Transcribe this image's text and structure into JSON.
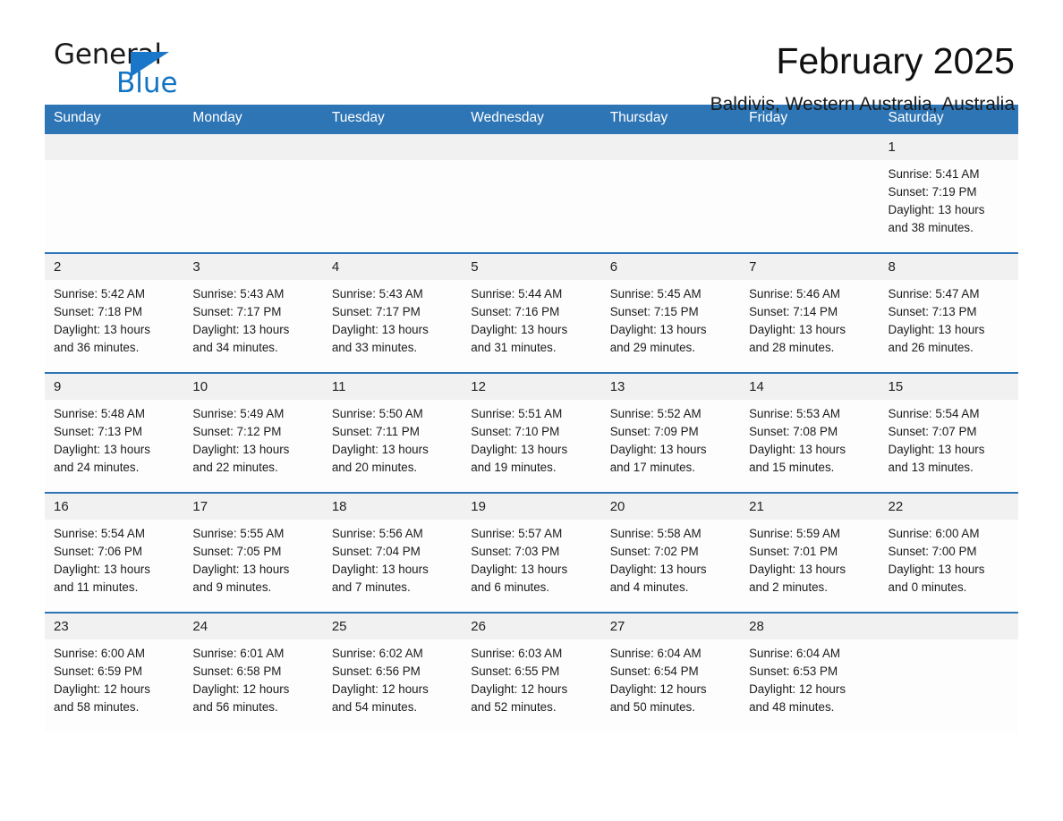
{
  "brand": {
    "name_part1": "General",
    "name_part2": "Blue",
    "triangle_color": "#1976c8",
    "blue_text_color": "#1275c4"
  },
  "header": {
    "title": "February 2025",
    "subtitle": "Baldivis, Western Australia, Australia",
    "accent_color": "#2e75b6",
    "daynum_band_color": "#f1f1f1"
  },
  "calendar": {
    "weekday_headers": [
      "Sunday",
      "Monday",
      "Tuesday",
      "Wednesday",
      "Thursday",
      "Friday",
      "Saturday"
    ],
    "weeks": [
      [
        {
          "day": "",
          "lines": []
        },
        {
          "day": "",
          "lines": []
        },
        {
          "day": "",
          "lines": []
        },
        {
          "day": "",
          "lines": []
        },
        {
          "day": "",
          "lines": []
        },
        {
          "day": "",
          "lines": []
        },
        {
          "day": "1",
          "lines": [
            "Sunrise: 5:41 AM",
            "Sunset: 7:19 PM",
            "Daylight: 13 hours",
            "and 38 minutes."
          ]
        }
      ],
      [
        {
          "day": "2",
          "lines": [
            "Sunrise: 5:42 AM",
            "Sunset: 7:18 PM",
            "Daylight: 13 hours",
            "and 36 minutes."
          ]
        },
        {
          "day": "3",
          "lines": [
            "Sunrise: 5:43 AM",
            "Sunset: 7:17 PM",
            "Daylight: 13 hours",
            "and 34 minutes."
          ]
        },
        {
          "day": "4",
          "lines": [
            "Sunrise: 5:43 AM",
            "Sunset: 7:17 PM",
            "Daylight: 13 hours",
            "and 33 minutes."
          ]
        },
        {
          "day": "5",
          "lines": [
            "Sunrise: 5:44 AM",
            "Sunset: 7:16 PM",
            "Daylight: 13 hours",
            "and 31 minutes."
          ]
        },
        {
          "day": "6",
          "lines": [
            "Sunrise: 5:45 AM",
            "Sunset: 7:15 PM",
            "Daylight: 13 hours",
            "and 29 minutes."
          ]
        },
        {
          "day": "7",
          "lines": [
            "Sunrise: 5:46 AM",
            "Sunset: 7:14 PM",
            "Daylight: 13 hours",
            "and 28 minutes."
          ]
        },
        {
          "day": "8",
          "lines": [
            "Sunrise: 5:47 AM",
            "Sunset: 7:13 PM",
            "Daylight: 13 hours",
            "and 26 minutes."
          ]
        }
      ],
      [
        {
          "day": "9",
          "lines": [
            "Sunrise: 5:48 AM",
            "Sunset: 7:13 PM",
            "Daylight: 13 hours",
            "and 24 minutes."
          ]
        },
        {
          "day": "10",
          "lines": [
            "Sunrise: 5:49 AM",
            "Sunset: 7:12 PM",
            "Daylight: 13 hours",
            "and 22 minutes."
          ]
        },
        {
          "day": "11",
          "lines": [
            "Sunrise: 5:50 AM",
            "Sunset: 7:11 PM",
            "Daylight: 13 hours",
            "and 20 minutes."
          ]
        },
        {
          "day": "12",
          "lines": [
            "Sunrise: 5:51 AM",
            "Sunset: 7:10 PM",
            "Daylight: 13 hours",
            "and 19 minutes."
          ]
        },
        {
          "day": "13",
          "lines": [
            "Sunrise: 5:52 AM",
            "Sunset: 7:09 PM",
            "Daylight: 13 hours",
            "and 17 minutes."
          ]
        },
        {
          "day": "14",
          "lines": [
            "Sunrise: 5:53 AM",
            "Sunset: 7:08 PM",
            "Daylight: 13 hours",
            "and 15 minutes."
          ]
        },
        {
          "day": "15",
          "lines": [
            "Sunrise: 5:54 AM",
            "Sunset: 7:07 PM",
            "Daylight: 13 hours",
            "and 13 minutes."
          ]
        }
      ],
      [
        {
          "day": "16",
          "lines": [
            "Sunrise: 5:54 AM",
            "Sunset: 7:06 PM",
            "Daylight: 13 hours",
            "and 11 minutes."
          ]
        },
        {
          "day": "17",
          "lines": [
            "Sunrise: 5:55 AM",
            "Sunset: 7:05 PM",
            "Daylight: 13 hours",
            "and 9 minutes."
          ]
        },
        {
          "day": "18",
          "lines": [
            "Sunrise: 5:56 AM",
            "Sunset: 7:04 PM",
            "Daylight: 13 hours",
            "and 7 minutes."
          ]
        },
        {
          "day": "19",
          "lines": [
            "Sunrise: 5:57 AM",
            "Sunset: 7:03 PM",
            "Daylight: 13 hours",
            "and 6 minutes."
          ]
        },
        {
          "day": "20",
          "lines": [
            "Sunrise: 5:58 AM",
            "Sunset: 7:02 PM",
            "Daylight: 13 hours",
            "and 4 minutes."
          ]
        },
        {
          "day": "21",
          "lines": [
            "Sunrise: 5:59 AM",
            "Sunset: 7:01 PM",
            "Daylight: 13 hours",
            "and 2 minutes."
          ]
        },
        {
          "day": "22",
          "lines": [
            "Sunrise: 6:00 AM",
            "Sunset: 7:00 PM",
            "Daylight: 13 hours",
            "and 0 minutes."
          ]
        }
      ],
      [
        {
          "day": "23",
          "lines": [
            "Sunrise: 6:00 AM",
            "Sunset: 6:59 PM",
            "Daylight: 12 hours",
            "and 58 minutes."
          ]
        },
        {
          "day": "24",
          "lines": [
            "Sunrise: 6:01 AM",
            "Sunset: 6:58 PM",
            "Daylight: 12 hours",
            "and 56 minutes."
          ]
        },
        {
          "day": "25",
          "lines": [
            "Sunrise: 6:02 AM",
            "Sunset: 6:56 PM",
            "Daylight: 12 hours",
            "and 54 minutes."
          ]
        },
        {
          "day": "26",
          "lines": [
            "Sunrise: 6:03 AM",
            "Sunset: 6:55 PM",
            "Daylight: 12 hours",
            "and 52 minutes."
          ]
        },
        {
          "day": "27",
          "lines": [
            "Sunrise: 6:04 AM",
            "Sunset: 6:54 PM",
            "Daylight: 12 hours",
            "and 50 minutes."
          ]
        },
        {
          "day": "28",
          "lines": [
            "Sunrise: 6:04 AM",
            "Sunset: 6:53 PM",
            "Daylight: 12 hours",
            "and 48 minutes."
          ]
        },
        {
          "day": "",
          "lines": []
        }
      ]
    ]
  }
}
